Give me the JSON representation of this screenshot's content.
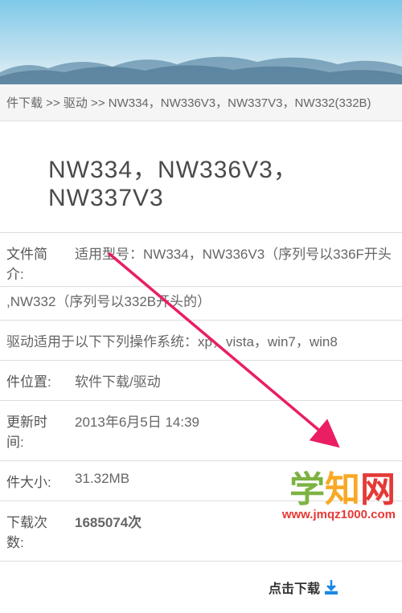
{
  "breadcrumb": {
    "item1": "件下载",
    "sep": " >> ",
    "item2": "驱动",
    "sep2": " >> ",
    "item3": "NW334，NW336V3，NW337V3，NW332(332B)"
  },
  "title": "NW334，NW336V3，NW337V3",
  "info": {
    "desc_label": "文件简介:",
    "desc_line1": "适用型号：NW334，NW336V3（序列号以336F开头",
    "desc_line2": ",NW332（序列号以332B开头的）",
    "sys_text": "驱动适用于以下下列操作系统：xp，vista，win7，win8",
    "loc_label": "件位置:",
    "loc_value": "软件下载/驱动",
    "time_label": "更新时间:",
    "time_value": "2013年6月5日 14:39",
    "size_label": "件大小:",
    "size_value": "31.32MB",
    "count_label": "下载次数:",
    "count_value": "1685074次"
  },
  "download_label": "点击下载",
  "watermark": {
    "char1": "学",
    "char2": "知",
    "char3": "网",
    "url": "www.jmqz1000.com"
  }
}
